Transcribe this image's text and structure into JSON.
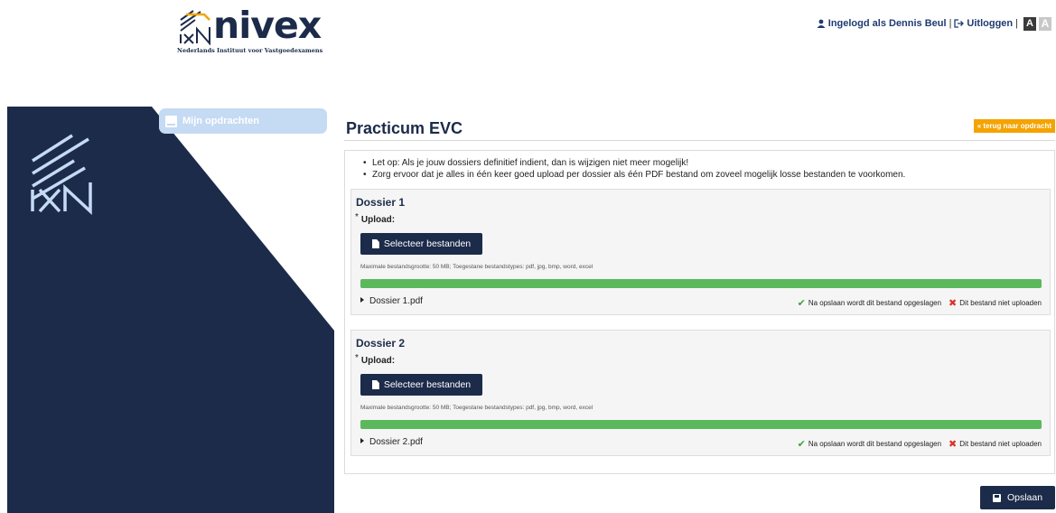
{
  "header": {
    "logo_word": "nivex",
    "logo_subtitle": "Nederlands Instituut voor Vastgoedexamens",
    "user_label": "Ingelogd als Dennis Beul",
    "separator": "|",
    "logout_label": "Uitloggen",
    "font_large": "A",
    "font_small": "A"
  },
  "sidebar": {
    "items": [
      {
        "label": "Mijn opdrachten",
        "icon": "tablet-icon"
      }
    ],
    "colors": {
      "background": "#1c2b4a",
      "nav_item": "#c5daf3"
    }
  },
  "main": {
    "title": "Practicum EVC",
    "back_button": "« terug naar opdracht",
    "notes": [
      "Let op: Als je jouw dossiers definitief indient, dan is wijzigen niet meer mogelijk!",
      "Zorg ervoor dat je alles in één keer goed upload per dossier als één PDF bestand om zoveel mogelijk losse bestanden te voorkomen."
    ],
    "dossiers": [
      {
        "title": "Dossier 1",
        "required_marker": "*",
        "upload_label": "Upload:",
        "select_button": "Selecteer bestanden",
        "max_size_text": "Maximale bestandsgrootte: 50 MB; Toegestane bestandstypes: pdf, jpg, bmp, word, excel",
        "progress": 1.0,
        "file_name": "Dossier 1.pdf",
        "keep_text": "Na opslaan wordt dit bestand opgeslagen",
        "remove_text": "Dit bestand niet uploaden"
      },
      {
        "title": "Dossier 2",
        "required_marker": "*",
        "upload_label": "Upload:",
        "select_button": "Selecteer bestanden",
        "max_size_text": "Maximale bestandsgrootte: 50 MB; Toegestane bestandstypes: pdf, jpg, bmp, word, excel",
        "progress": 1.0,
        "file_name": "Dossier 2.pdf",
        "keep_text": "Na opslaan wordt dit bestand opgeslagen",
        "remove_text": "Dit bestand niet uploaden"
      }
    ],
    "save_button": "Opslaan"
  },
  "colors": {
    "navy": "#1c2b4a",
    "accent_orange": "#f4a300",
    "progress_green": "#5cb85c",
    "check_green": "#3fa33f",
    "remove_red": "#d9342b"
  }
}
